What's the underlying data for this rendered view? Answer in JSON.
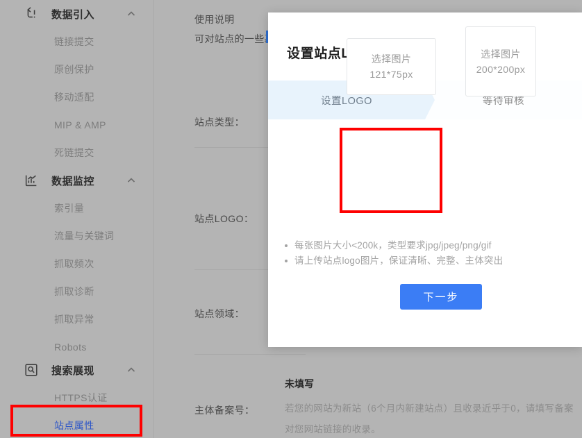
{
  "colors": {
    "overlay_dim": "#b4b4b4",
    "annotation_red": "#fe0000",
    "active_nav_blue": "#2c55c8",
    "primary_button_blue": "#3b7df5",
    "step_active_bg": "#e8f3fc"
  },
  "sidebar": {
    "groups": [
      {
        "label": "数据引入",
        "icon": "data-import-icon",
        "expanded": true,
        "items": [
          {
            "label": "链接提交",
            "active": false
          },
          {
            "label": "原创保护",
            "active": false
          },
          {
            "label": "移动适配",
            "active": false
          },
          {
            "label": "MIP & AMP",
            "active": false
          },
          {
            "label": "死链提交",
            "active": false
          }
        ]
      },
      {
        "label": "数据监控",
        "icon": "chart-monitor-icon",
        "expanded": true,
        "items": [
          {
            "label": "索引量",
            "active": false
          },
          {
            "label": "流量与关键词",
            "active": false
          },
          {
            "label": "抓取频次",
            "active": false
          },
          {
            "label": "抓取诊断",
            "active": false
          },
          {
            "label": "抓取异常",
            "active": false
          },
          {
            "label": "Robots",
            "active": false
          }
        ]
      },
      {
        "label": "搜索展现",
        "icon": "search-display-icon",
        "expanded": true,
        "items": [
          {
            "label": "HTTPS认证",
            "active": false
          },
          {
            "label": "站点属性",
            "active": true
          }
        ]
      }
    ]
  },
  "background_page": {
    "usage_title": "使用说明",
    "usage_desc": "可对站点的一些基",
    "labels": {
      "site_type": "站点类型：",
      "site_logo": "站点LOGO：",
      "site_field": "站点领域：",
      "icp_number": "主体备案号："
    },
    "not_filled": "未填写",
    "icp_help_line1": "若您的网站为新站（6个月内新建站点）且收录近乎于0，请填写备案",
    "icp_help_line2": "对您网站链接的收录。"
  },
  "modal": {
    "title": "设置站点LOGO",
    "steps": [
      {
        "label": "设置LOGO",
        "active": true
      },
      {
        "label": "等待审核",
        "active": false
      }
    ],
    "uploaders": [
      {
        "action_label": "选择图片",
        "size_label": "121*75px",
        "highlighted": true
      },
      {
        "action_label": "选择图片",
        "size_label": "200*200px",
        "highlighted": false
      }
    ],
    "hints": [
      "每张图片大小<200k，类型要求jpg/jpeg/png/gif",
      "请上传站点logo图片，保证清晰、完整、主体突出"
    ],
    "next_button": "下一步"
  }
}
